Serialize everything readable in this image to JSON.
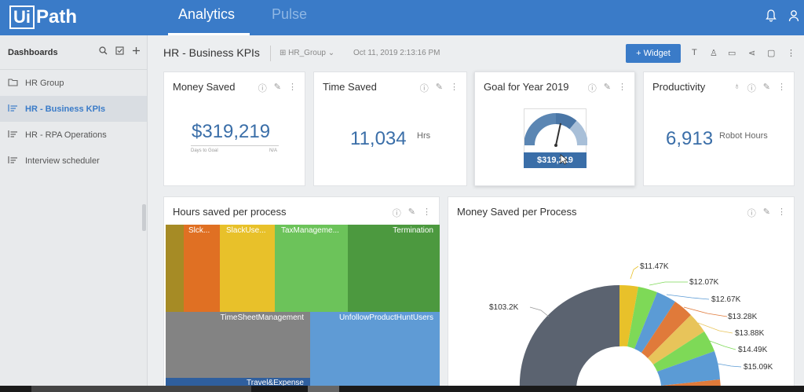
{
  "app": {
    "logo_box": "Ui",
    "logo_rest": "Path",
    "tabs": [
      "Analytics",
      "Pulse"
    ]
  },
  "sidebar": {
    "title": "Dashboards",
    "items": [
      {
        "label": "HR Group",
        "icon": "folder-icon"
      },
      {
        "label": "HR - Business KPIs",
        "icon": "dashboard-icon"
      },
      {
        "label": "HR - RPA Operations",
        "icon": "dashboard-icon"
      },
      {
        "label": "Interview scheduler",
        "icon": "dashboard-icon"
      }
    ]
  },
  "dashboard": {
    "title": "HR - Business KPIs",
    "group": "HR_Group",
    "date": "Oct 11, 2019 2:13:16 PM",
    "widget_button": "+ Widget"
  },
  "cards": {
    "money_saved": {
      "title": "Money Saved",
      "value": "$319,219",
      "sub_left": "Days to Goal",
      "sub_right": "N/A"
    },
    "time_saved": {
      "title": "Time Saved",
      "value": "11,034",
      "unit": "Hrs"
    },
    "goal": {
      "title": "Goal for Year 2019",
      "value": "$319,219"
    },
    "productivity": {
      "title": "Productivity",
      "value": "6,913",
      "unit": "Robot Hours"
    },
    "hours_process": {
      "title": "Hours saved per process"
    },
    "money_process": {
      "title": "Money Saved per Process"
    }
  },
  "treemap": {
    "labels": [
      "Slck...",
      "SlackUse...",
      "TaxManageme...",
      "Termination",
      "TimeSheetManagement",
      "UnfollowProductHuntUsers",
      "Travel&Expense"
    ]
  },
  "donut": {
    "labels": [
      "$103.2K",
      "$11.47K",
      "$12.07K",
      "$12.67K",
      "$13.28K",
      "$13.88K",
      "$14.49K",
      "$15.09K"
    ]
  }
}
